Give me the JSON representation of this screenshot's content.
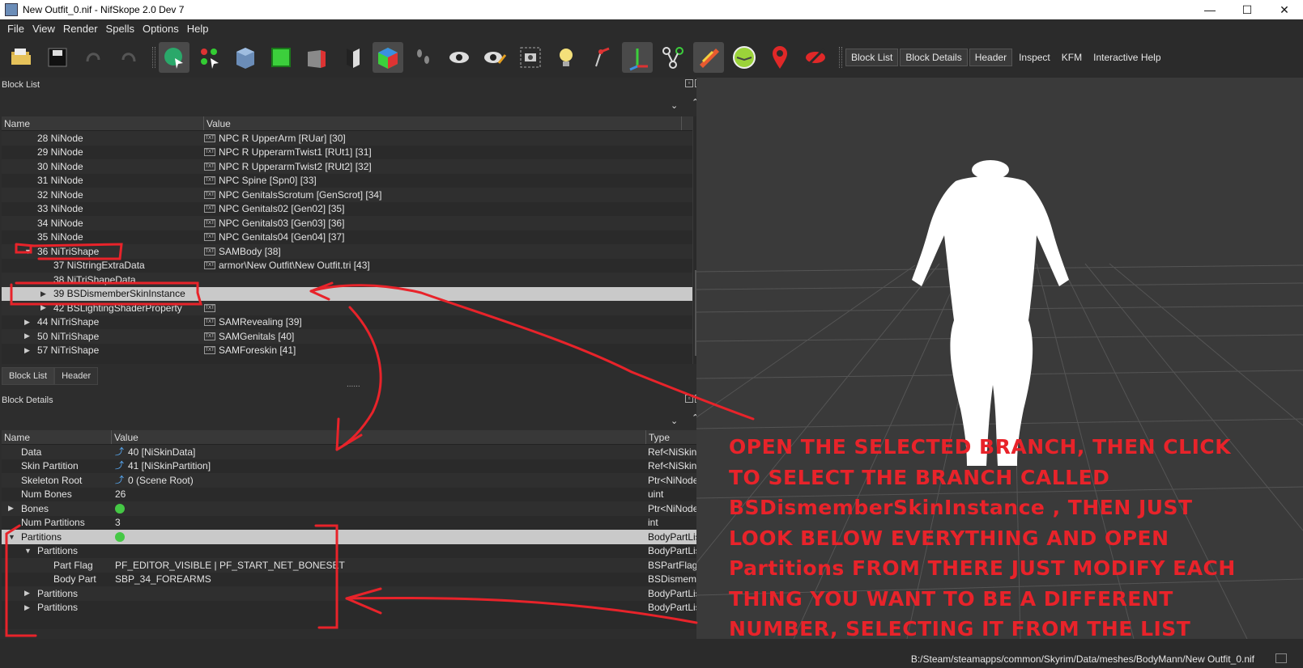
{
  "window": {
    "title": "New Outfit_0.nif - NifSkope 2.0 Dev 7",
    "minimize": "—",
    "maximize": "☐",
    "close": "✕"
  },
  "menu": [
    "File",
    "View",
    "Render",
    "Spells",
    "Options",
    "Help"
  ],
  "toolbar": {
    "text_buttons": [
      "Block List",
      "Block Details",
      "Header",
      "Inspect",
      "KFM",
      "Interactive Help"
    ]
  },
  "block_list": {
    "title": "Block List",
    "columns": [
      "Name",
      "Value"
    ],
    "rows": [
      {
        "name": "28 NiNode",
        "value": "NPC R UpperArm [RUar] [30]"
      },
      {
        "name": "29 NiNode",
        "value": "NPC R UpperarmTwist1 [RUt1] [31]"
      },
      {
        "name": "30 NiNode",
        "value": "NPC R UpperarmTwist2 [RUt2] [32]"
      },
      {
        "name": "31 NiNode",
        "value": "NPC Spine [Spn0] [33]"
      },
      {
        "name": "32 NiNode",
        "value": "NPC GenitalsScrotum [GenScrot] [34]"
      },
      {
        "name": "33 NiNode",
        "value": "NPC Genitals02 [Gen02] [35]"
      },
      {
        "name": "34 NiNode",
        "value": "NPC Genitals03 [Gen03] [36]"
      },
      {
        "name": "35 NiNode",
        "value": "NPC Genitals04 [Gen04] [37]"
      },
      {
        "name": "36 NiTriShape",
        "value": "SAMBody [38]"
      },
      {
        "name": "37 NiStringExtraData",
        "value": "armor\\New Outfit\\New Outfit.tri [43]"
      },
      {
        "name": "38 NiTriShapeData",
        "value": ""
      },
      {
        "name": "39 BSDismemberSkinInstance",
        "value": ""
      },
      {
        "name": "42 BSLightingShaderProperty",
        "value": ""
      },
      {
        "name": "44 NiTriShape",
        "value": "SAMRevealing [39]"
      },
      {
        "name": "50 NiTriShape",
        "value": "SAMGenitals [40]"
      },
      {
        "name": "57 NiTriShape",
        "value": "SAMForeskin [41]"
      }
    ],
    "tabs": [
      "Block List",
      "Header"
    ],
    "splitter": "......"
  },
  "block_details": {
    "title": "Block Details",
    "columns": [
      "Name",
      "Value",
      "Type"
    ],
    "rows": [
      {
        "name": "Data",
        "value": "40 [NiSkinData]",
        "type": "Ref<NiSkinDa"
      },
      {
        "name": "Skin Partition",
        "value": "41 [NiSkinPartition]",
        "type": "Ref<NiSkinPa"
      },
      {
        "name": "Skeleton Root",
        "value": "0 (Scene Root)",
        "type": "Ptr<NiNode>"
      },
      {
        "name": "Num Bones",
        "value": "26",
        "type": "uint"
      },
      {
        "name": "Bones",
        "value": "",
        "type": "Ptr<NiNode>"
      },
      {
        "name": "Num Partitions",
        "value": "3",
        "type": "int"
      },
      {
        "name": "Partitions",
        "value": "",
        "type": "BodyPartList"
      },
      {
        "name": "Partitions",
        "value": "",
        "type": "BodyPartList"
      },
      {
        "name": "Part Flag",
        "value": "PF_EDITOR_VISIBLE | PF_START_NET_BONESET",
        "type": "BSPartFlag"
      },
      {
        "name": "Body Part",
        "value": "SBP_34_FOREARMS",
        "type": "BSDismembe"
      },
      {
        "name": "Partitions",
        "value": "",
        "type": "BodyPartList"
      },
      {
        "name": "Partitions",
        "value": "",
        "type": "BodyPartList"
      }
    ]
  },
  "status_bar": {
    "path": "B:/Steam/steamapps/common/Skyrim/Data/meshes/BodyMann/New Outfit_0.nif"
  },
  "annotation": {
    "lines": [
      "OPEN THE SELECTED BRANCH, THEN CLICK",
      "TO SELECT THE BRANCH CALLED",
      "BSDismemberSkinInstance  , THEN JUST",
      "LOOK BELOW EVERYTHING AND OPEN",
      "Partitions  FROM THERE JUST MODIFY EACH",
      "THING YOU WANT TO BE A DIFFERENT",
      "NUMBER, SELECTING IT FROM THE LIST"
    ],
    "color": "#e8232a"
  },
  "colors": {
    "background": "#2d2d2d",
    "viewport": "#3a3a3a",
    "selected_row": "#c9c9c9"
  }
}
